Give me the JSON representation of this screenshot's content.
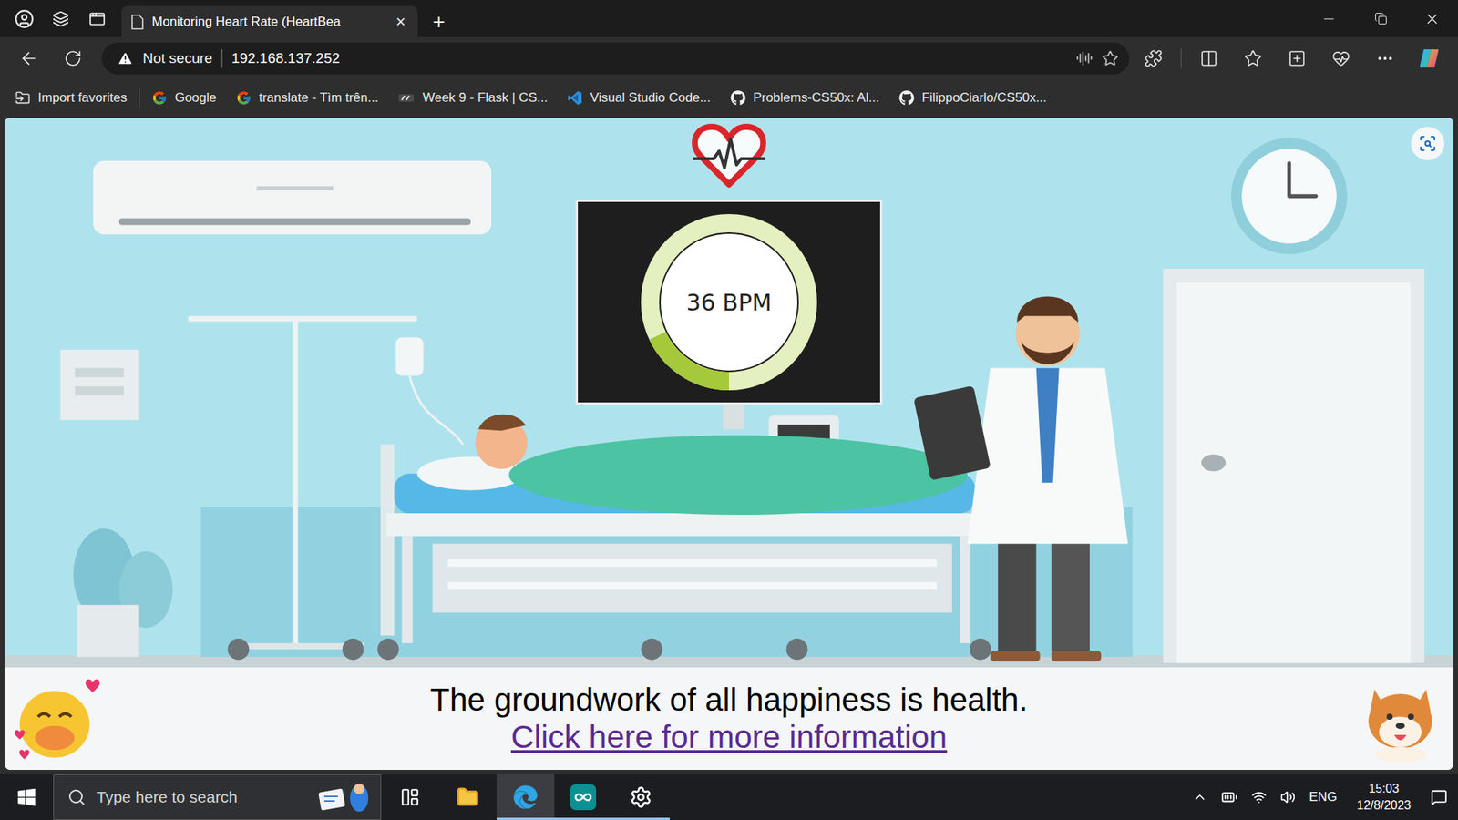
{
  "browser": {
    "tab": {
      "title": "Monitoring Heart Rate (HeartBea",
      "close": "×",
      "selected": true
    },
    "new_tab": "+",
    "security": "Not secure",
    "address": "192.168.137.252",
    "favorites": [
      {
        "label": "Import favorites",
        "kind": "import"
      },
      {
        "label": "Google",
        "kind": "google"
      },
      {
        "label": "translate - Tìm trên...",
        "kind": "google"
      },
      {
        "label": "Week 9 - Flask | CS...",
        "kind": "edx"
      },
      {
        "label": "Visual Studio Code...",
        "kind": "vscode"
      },
      {
        "label": "Problems-CS50x: Al...",
        "kind": "github"
      },
      {
        "label": "FilippoCiarlo/CS50x...",
        "kind": "github"
      }
    ]
  },
  "page": {
    "monitor": {
      "reading": "36 BPM",
      "level": 0.18
    },
    "quote": "The groundwork of all happiness is health.",
    "link": "Click here for more information"
  },
  "taskbar": {
    "search": {
      "placeholder": "Type here to search"
    },
    "apps": [
      {
        "kind": "task-view",
        "running": false,
        "selected": false
      },
      {
        "kind": "file-explorer",
        "running": false,
        "selected": false
      },
      {
        "kind": "edge",
        "running": true,
        "selected": true
      },
      {
        "kind": "arduino",
        "running": true,
        "selected": false
      },
      {
        "kind": "settings",
        "running": true,
        "selected": false
      }
    ],
    "language": "ENG",
    "time": "15:03",
    "date": "12/8/2023"
  }
}
